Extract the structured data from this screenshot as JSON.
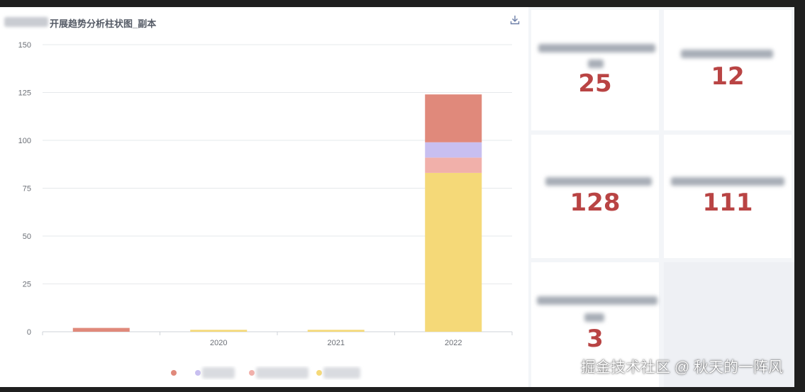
{
  "chart": {
    "title": "开展趋势分析柱状图_副本"
  },
  "chart_data": {
    "type": "bar",
    "stacked": true,
    "categories": [
      "",
      "2020",
      "2021",
      "2022"
    ],
    "ylim": [
      0,
      150
    ],
    "yticks": [
      0,
      25,
      50,
      75,
      100,
      125,
      150
    ],
    "grid": true,
    "legend_placement": "bottom",
    "series": [
      {
        "color": "#f5d978",
        "values": [
          0,
          1,
          1,
          83
        ]
      },
      {
        "color": "#f1b0aa",
        "values": [
          0,
          0,
          0,
          8
        ]
      },
      {
        "color": "#c8bff0",
        "values": [
          0,
          0,
          0,
          8
        ]
      },
      {
        "color": "#e0897b",
        "values": [
          2,
          0,
          0,
          25
        ]
      }
    ]
  },
  "kpis": [
    {
      "value": "25"
    },
    {
      "value": "12"
    },
    {
      "value": "128"
    },
    {
      "value": "111"
    },
    {
      "value": "3"
    }
  ],
  "watermark": "掘金技术社区 @ 秋天的一阵风",
  "colors": {
    "kpi_value": "#b94444",
    "grid": "#e6e8eb"
  }
}
